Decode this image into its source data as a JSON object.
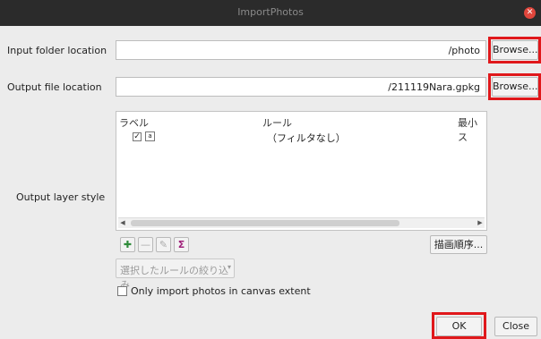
{
  "window": {
    "title": "ImportPhotos",
    "close_glyph": "✕"
  },
  "input_folder": {
    "label": "Input folder location",
    "value": "/photo",
    "browse": "Browse..."
  },
  "output_file": {
    "label": "Output file location",
    "value": "/211119Nara.gpkg",
    "browse": "Browse..."
  },
  "layer_style": {
    "label": "Output layer style",
    "columns": [
      "ラベル",
      "ルール",
      "最小ス"
    ],
    "rows": [
      {
        "checked": true,
        "label_icon": "abc-icon",
        "rule": "（フィルタなし）"
      }
    ],
    "render_order_button": "描画順序...",
    "refine_dropdown": "選択したルールの絞り込み"
  },
  "tools": [
    "add-rule-icon",
    "remove-rule-icon",
    "edit-rule-icon",
    "sum-icon"
  ],
  "only_canvas": {
    "label": "Only import photos in canvas extent",
    "checked": false
  },
  "footer": {
    "ok": "OK",
    "close": "Close"
  },
  "colors": {
    "titlebar": "#2b2b2b",
    "highlight": "#e0181b",
    "close_dot": "#e0463c"
  }
}
